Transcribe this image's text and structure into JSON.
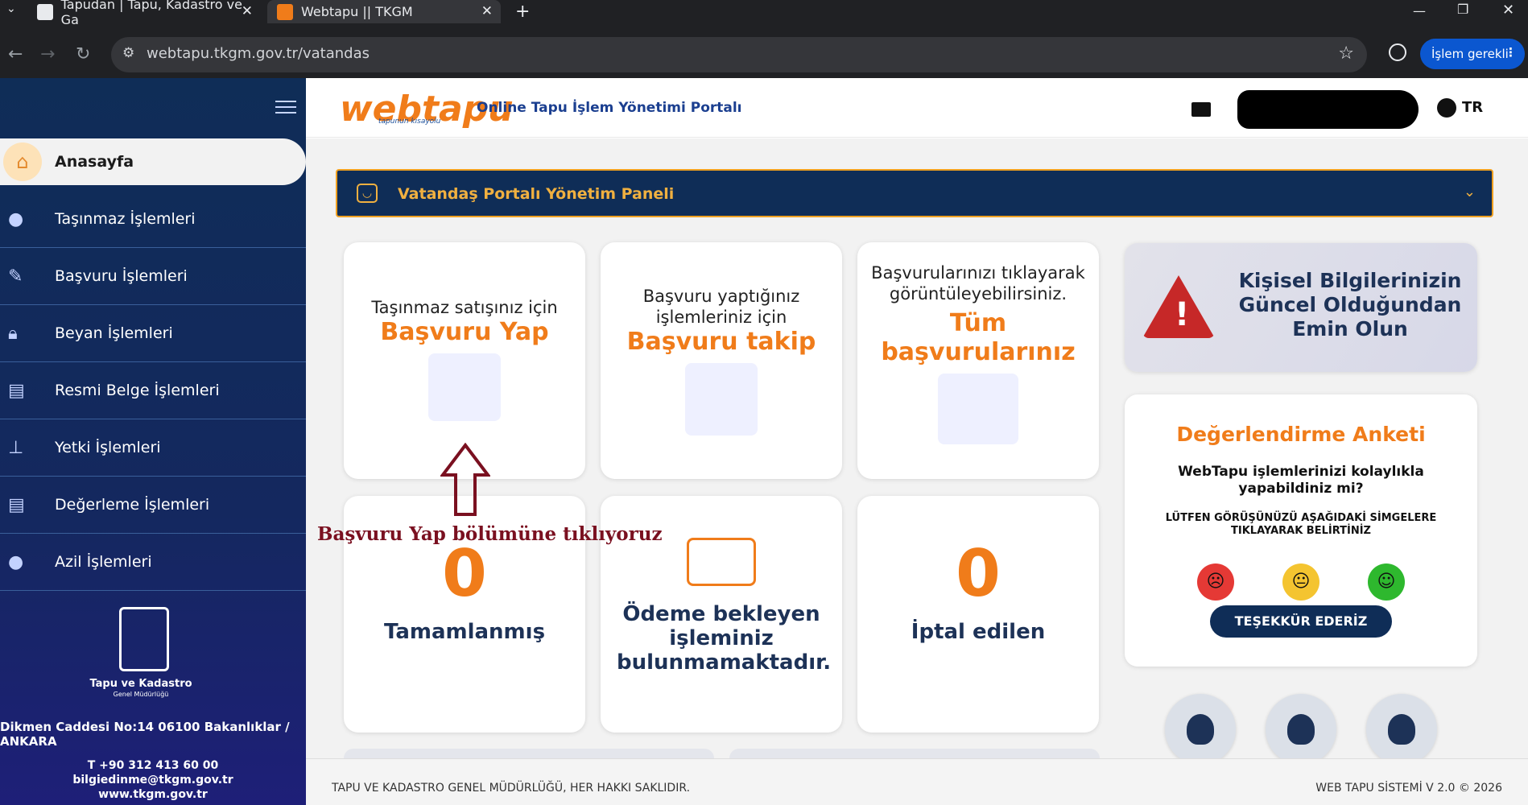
{
  "browser": {
    "tabs": [
      {
        "title": "Tapudan | Tapu, Kadastro ve Ga",
        "active": false
      },
      {
        "title": "Webtapu || TKGM",
        "active": true
      }
    ],
    "url": "webtapu.tkgm.gov.tr/vatandas",
    "action_label": "İşlem gerekli",
    "new_tab": "+"
  },
  "header": {
    "logo_web": "web",
    "logo_tapu": "tapu",
    "logo_sub": "tapunun kısayolu",
    "portal_title": "Online Tapu İşlem Yönetimi Portalı",
    "lang": "TR"
  },
  "sidebar": {
    "home": "Anasayfa",
    "items": [
      {
        "label": "Taşınmaz İşlemleri",
        "icon": "location-pin-icon"
      },
      {
        "label": "Başvuru İşlemleri",
        "icon": "pen-icon"
      },
      {
        "label": "Beyan İşlemleri",
        "icon": "lock-icon"
      },
      {
        "label": "Resmi Belge İşlemleri",
        "icon": "document-icon"
      },
      {
        "label": "Yetki İşlemleri",
        "icon": "stamp-icon"
      },
      {
        "label": "Değerleme İşlemleri",
        "icon": "document-icon"
      },
      {
        "label": "Azil İşlemleri",
        "icon": "location-pin-icon"
      }
    ],
    "org_name": "Tapu ve Kadastro",
    "org_sub": "Genel Müdürlüğü",
    "address": "Dikmen Caddesi No:14 06100 Bakanlıklar / ANKARA",
    "phone": "T +90 312 413 60 00",
    "email": "bilgiedinme@tkgm.gov.tr",
    "web": "www.tkgm.gov.tr"
  },
  "panel": {
    "title": "Vatandaş Portalı Yönetim Paneli"
  },
  "cards": {
    "apply": {
      "t1": "Taşınmaz satışınız için",
      "t2": "Başvuru Yap"
    },
    "track": {
      "t1": "Başvuru yaptığınız işlemleriniz için",
      "t2": "Başvuru takip"
    },
    "all": {
      "t1": "Başvurularınızı tıklayarak görüntüleyebilirsiniz.",
      "t2": "Tüm başvurularınız"
    },
    "completed": {
      "count": "0",
      "label": "Tamamlanmış"
    },
    "payment": {
      "label": "Ödeme bekleyen işleminiz bulunmamaktadır."
    },
    "cancelled": {
      "count": "0",
      "label": "İptal edilen"
    }
  },
  "info": {
    "text": "Kişisel Bilgilerinizin Güncel Olduğundan Emin Olun"
  },
  "survey": {
    "title": "Değerlendirme Anketi",
    "question": "WebTapu işlemlerinizi kolaylıkla yapabildiniz mi?",
    "note": "LÜTFEN GÖRÜŞÜNÜZÜ AŞAĞIDAKİ SİMGELERE TIKLAYARAK BELİRTİNİZ",
    "thanks": "TEŞEKKÜR EDERİZ",
    "faces": [
      {
        "name": "sad-face-icon",
        "color": "#e53935"
      },
      {
        "name": "neutral-face-icon",
        "color": "#f4c430"
      },
      {
        "name": "happy-face-icon",
        "color": "#2eb82e"
      }
    ]
  },
  "annotation": {
    "text": "Başvuru Yap bölümüne tıklıyoruz"
  },
  "footer": {
    "left": "TAPU VE KADASTRO GENEL MÜDÜRLÜĞÜ, HER HAKKI SAKLIDIR.",
    "right": "WEB TAPU SİSTEMİ V 2.0 © 2026"
  }
}
